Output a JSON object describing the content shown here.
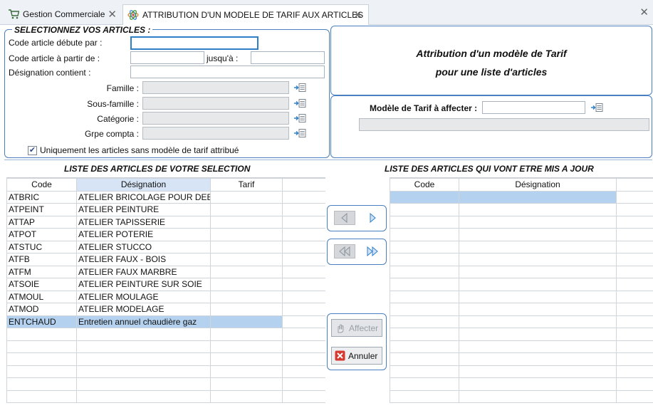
{
  "tabs": [
    {
      "label": "Gestion Commerciale",
      "icon": "cart-icon"
    },
    {
      "label": "ATTRIBUTION D'UN MODELE DE TARIF AUX ARTICLES",
      "icon": "atom-icon"
    }
  ],
  "selection": {
    "legend": "SELECTIONNEZ VOS ARTICLES :",
    "code_starts_label": "Code article débute par :",
    "code_starts_value": "",
    "code_from_label": "Code article à partir de :",
    "code_from_value": "",
    "code_to_label": "jusqu'à :",
    "code_to_value": "",
    "designation_label": "Désignation contient :",
    "designation_value": "",
    "famille_label": "Famille :",
    "famille_value": "",
    "sousfamille_label": "Sous-famille :",
    "sousfamille_value": "",
    "categorie_label": "Catégorie :",
    "categorie_value": "",
    "grpecompta_label": "Grpe compta :",
    "grpecompta_value": "",
    "checkbox_label": "Uniquement les articles sans modèle de tarif attribué",
    "checkbox_checked": true
  },
  "title_panel": {
    "line1": "Attribution d'un modèle de Tarif",
    "line2": "pour une liste d'articles"
  },
  "model_panel": {
    "label": "Modèle de Tarif à affecter :",
    "value": ""
  },
  "left_grid": {
    "title": "LISTE DES ARTICLES DE VOTRE SELECTION",
    "headers": [
      "Code",
      "Désignation",
      "Tarif"
    ],
    "rows": [
      [
        "ATBRIC",
        "ATELIER BRICOLAGE POUR DEB",
        ""
      ],
      [
        "ATPEINT",
        "ATELIER PEINTURE",
        ""
      ],
      [
        "ATTAP",
        "ATELIER TAPISSERIE",
        ""
      ],
      [
        "ATPOT",
        "ATELIER POTERIE",
        ""
      ],
      [
        "ATSTUC",
        "ATELIER STUCCO",
        ""
      ],
      [
        "ATFB",
        "ATELIER FAUX - BOIS",
        ""
      ],
      [
        "ATFM",
        "ATELIER FAUX MARBRE",
        ""
      ],
      [
        "ATSOIE",
        "ATELIER PEINTURE SUR SOIE",
        ""
      ],
      [
        "ATMOUL",
        "ATELIER MOULAGE",
        ""
      ],
      [
        "ATMOD",
        "ATELIER MODELAGE",
        ""
      ],
      [
        "ENTCHAUD",
        "Entretien annuel chaudière gaz",
        ""
      ]
    ],
    "selected_row": 10
  },
  "right_grid": {
    "title": "LISTE DES ARTICLES QUI VONT ETRE MIS A JOUR",
    "headers": [
      "Code",
      "Désignation"
    ]
  },
  "buttons": {
    "affecter": "Affecter",
    "annuler": "Annuler"
  },
  "colors": {
    "accent": "#4a7fc1",
    "selection": "#b4d1ef"
  }
}
